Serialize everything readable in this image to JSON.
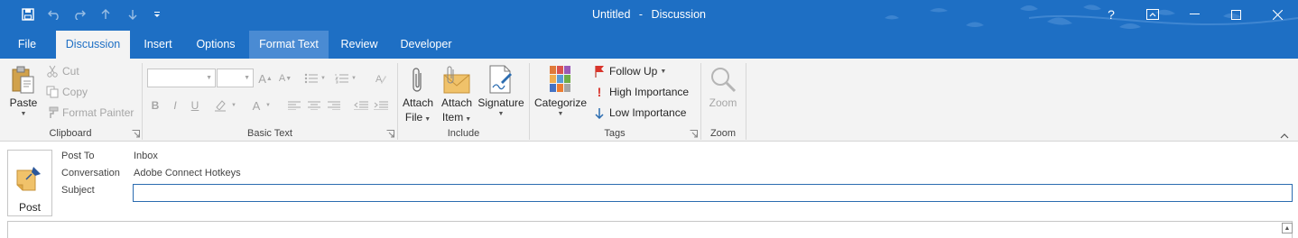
{
  "window": {
    "title": "Untitled",
    "separator": "-",
    "subtitle": "Discussion"
  },
  "quick_access": [
    "save-icon",
    "undo-icon",
    "redo-icon",
    "up-icon",
    "down-icon",
    "customize-icon"
  ],
  "window_controls": {
    "help": "?"
  },
  "tabs": [
    {
      "label": "File"
    },
    {
      "label": "Discussion"
    },
    {
      "label": "Insert"
    },
    {
      "label": "Options"
    },
    {
      "label": "Format Text"
    },
    {
      "label": "Review"
    },
    {
      "label": "Developer"
    }
  ],
  "ribbon": {
    "clipboard": {
      "paste": "Paste",
      "cut": "Cut",
      "copy": "Copy",
      "format_painter": "Format Painter",
      "label": "Clipboard"
    },
    "basic_text": {
      "bold": "B",
      "italic": "I",
      "underline": "U",
      "label": "Basic Text"
    },
    "include": {
      "attach_file_1": "Attach",
      "attach_file_2": "File",
      "attach_item_1": "Attach",
      "attach_item_2": "Item",
      "signature": "Signature",
      "label": "Include"
    },
    "tags": {
      "categorize": "Categorize",
      "follow_up": "Follow Up",
      "high_importance": "High Importance",
      "low_importance": "Low Importance",
      "label": "Tags"
    },
    "zoom": {
      "zoom_button": "Zoom",
      "label": "Zoom"
    }
  },
  "form": {
    "post_button": "Post",
    "post_to_label": "Post To",
    "post_to_value": "Inbox",
    "conversation_label": "Conversation",
    "conversation_value": "Adobe Connect Hotkeys",
    "subject_label": "Subject",
    "subject_value": ""
  },
  "colors": {
    "titlebar": "#1e6fc4",
    "ribbon_bg": "#f3f3f3",
    "accent": "#1e6fc4"
  }
}
